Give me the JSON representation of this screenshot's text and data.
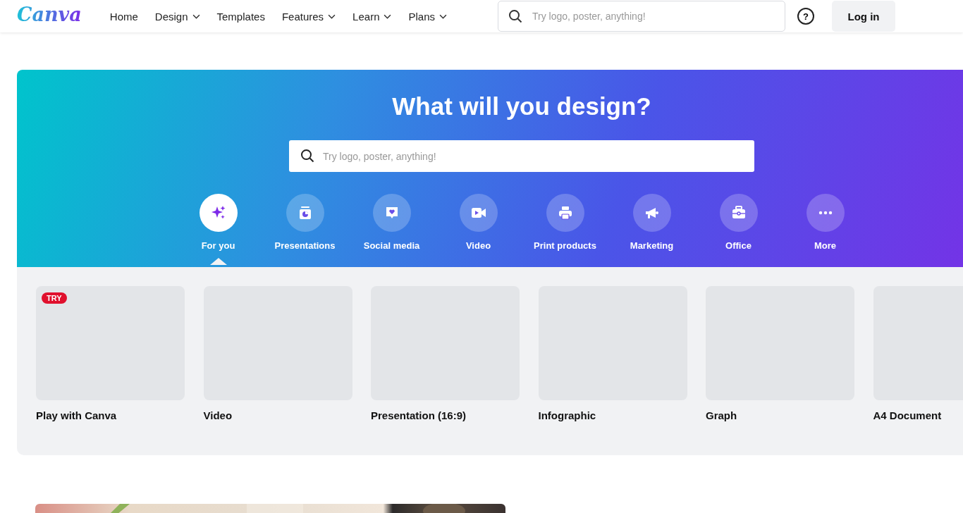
{
  "header": {
    "logo": "Canva",
    "nav": [
      {
        "label": "Home",
        "dropdown": false
      },
      {
        "label": "Design",
        "dropdown": true
      },
      {
        "label": "Templates",
        "dropdown": false
      },
      {
        "label": "Features",
        "dropdown": true
      },
      {
        "label": "Learn",
        "dropdown": true
      },
      {
        "label": "Plans",
        "dropdown": true
      }
    ],
    "search": {
      "placeholder": "Try logo, poster, anything!"
    },
    "help": "?",
    "login": "Log in"
  },
  "hero": {
    "title": "What will you design?",
    "search": {
      "placeholder": "Try logo, poster, anything!"
    },
    "categories": [
      {
        "label": "For you",
        "kind": "sparkle",
        "selected": true
      },
      {
        "label": "Presentations",
        "kind": "presentation",
        "selected": false
      },
      {
        "label": "Social media",
        "kind": "heart",
        "selected": false
      },
      {
        "label": "Video",
        "kind": "video",
        "selected": false
      },
      {
        "label": "Print products",
        "kind": "printer",
        "selected": false
      },
      {
        "label": "Marketing",
        "kind": "megaphone",
        "selected": false
      },
      {
        "label": "Office",
        "kind": "briefcase",
        "selected": false
      },
      {
        "label": "More",
        "kind": "more",
        "selected": false
      }
    ]
  },
  "designs": [
    {
      "label": "Play with Canva",
      "badge": "TRY"
    },
    {
      "label": "Video"
    },
    {
      "label": "Presentation (16:9)"
    },
    {
      "label": "Infographic"
    },
    {
      "label": "Graph"
    },
    {
      "label": "A4 Document"
    }
  ]
}
